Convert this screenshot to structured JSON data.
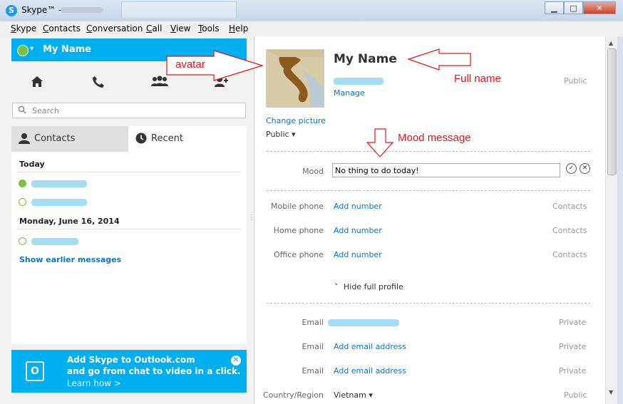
{
  "window": {
    "title": "Skype™ - ",
    "minimize": "▁",
    "maximize": "□",
    "close": "✕"
  },
  "menu": [
    {
      "u": "S",
      "rest": "kype"
    },
    {
      "u": "C",
      "rest": "ontacts"
    },
    {
      "u": "C",
      "rest": "onversation"
    },
    {
      "u": "C",
      "rest": "all"
    },
    {
      "u": "V",
      "rest": "iew"
    },
    {
      "u": "T",
      "rest": "ools"
    },
    {
      "u": "H",
      "rest": "elp"
    }
  ],
  "left": {
    "my_name": "My Name",
    "search_placeholder": "Search",
    "tabs": {
      "contacts": "Contacts",
      "recent": "Recent"
    },
    "groups": [
      {
        "heading": "Today"
      },
      {
        "heading": "Monday, June 16, 2014"
      }
    ],
    "show_earlier": "Show earlier messages",
    "promo": {
      "line1": "Add Skype to Outlook.com",
      "line2": "and go from chat to video in a click.",
      "line3": "Learn how >"
    }
  },
  "profile": {
    "name": "My Name",
    "manage": "Manage",
    "public_badge": "Public",
    "change_picture": "Change picture",
    "visibility": "Public ▾",
    "mood_label": "Mood",
    "mood_value": "No thing to do today!",
    "phones": [
      {
        "label": "Mobile phone",
        "action": "Add number",
        "privacy": "Contacts"
      },
      {
        "label": "Home phone",
        "action": "Add number",
        "privacy": "Contacts"
      },
      {
        "label": "Office phone",
        "action": "Add number",
        "privacy": "Contacts"
      }
    ],
    "hide_full_profile": "Hide full profile",
    "emails": [
      {
        "label": "Email",
        "action": "",
        "privacy": "Private"
      },
      {
        "label": "Email",
        "action": "Add email address",
        "privacy": "Private"
      },
      {
        "label": "Email",
        "action": "Add email address",
        "privacy": "Private"
      }
    ],
    "country_label": "Country/Region",
    "country_value": "Vietnam ▾",
    "country_privacy": "Public"
  },
  "annotations": {
    "avatar": "avatar",
    "full_name": "Full name",
    "mood_message": "Mood message"
  },
  "colors": {
    "skype_blue": "#00aff0",
    "link": "#0a76c4",
    "annotation": "#e0191f",
    "online": "#7ac142"
  }
}
